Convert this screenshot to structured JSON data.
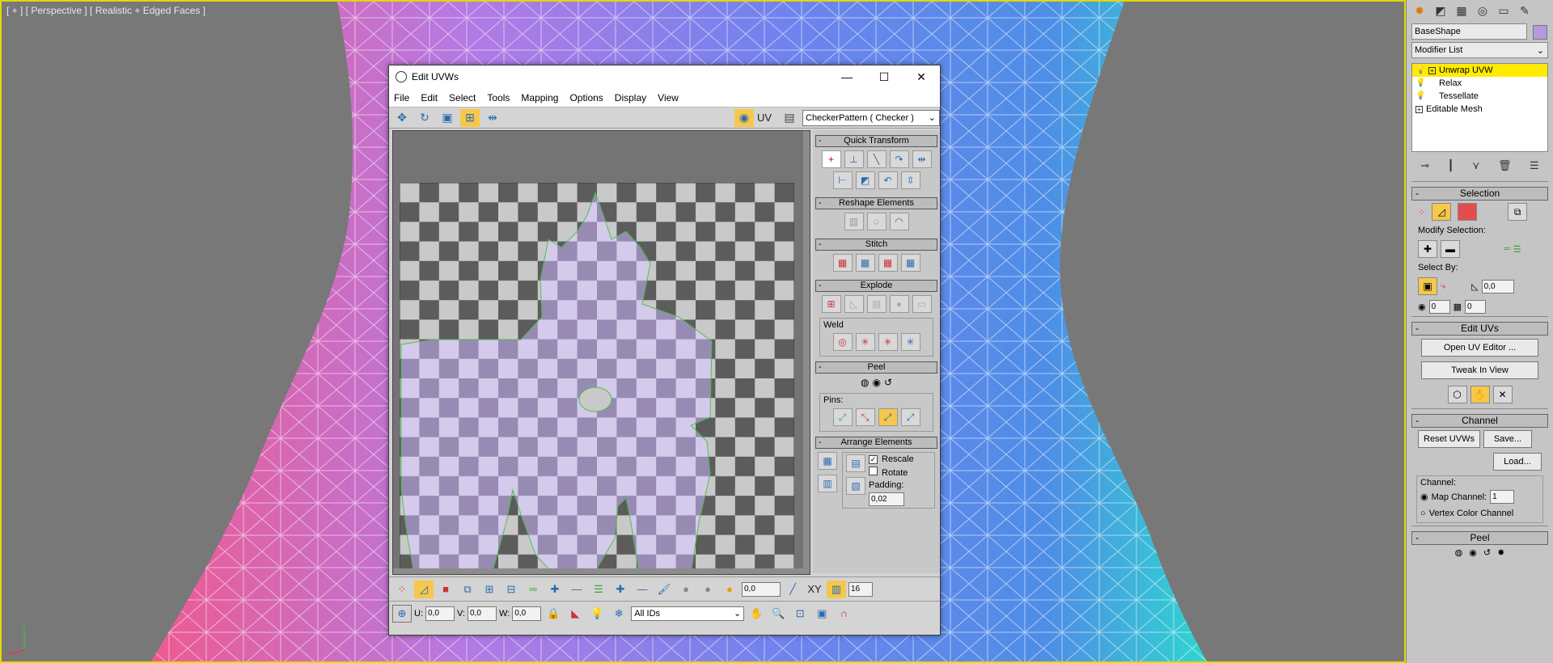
{
  "viewport": {
    "label": "[ + ] [ Perspective ] [ Realistic + Edged Faces ]"
  },
  "command_panel": {
    "object_name": "BaseShape",
    "modifier_list": "Modifier List",
    "modifiers": [
      {
        "label": "Unwrap UVW",
        "selected": true
      },
      {
        "label": "Relax",
        "selected": false
      },
      {
        "label": "Tessellate",
        "selected": false
      },
      {
        "label": "Editable Mesh",
        "selected": false
      }
    ],
    "selection": {
      "title": "Selection",
      "modify_selection": "Modify Selection:",
      "select_by": "Select By:",
      "angle_value": "0,0",
      "val1": "0",
      "val2": "0"
    },
    "edit_uvs": {
      "title": "Edit UVs",
      "open_button": "Open UV Editor ...",
      "tweak_button": "Tweak In View"
    },
    "channel": {
      "title": "Channel",
      "reset": "Reset UVWs",
      "save": "Save...",
      "load": "Load...",
      "channel_label": "Channel:",
      "map_channel": "Map Channel:",
      "map_channel_value": "1",
      "vertex_color": "Vertex Color Channel"
    },
    "peel_title": "Peel"
  },
  "uv_editor": {
    "title": "Edit UVWs",
    "menus": [
      "File",
      "Edit",
      "Select",
      "Tools",
      "Mapping",
      "Options",
      "Display",
      "View"
    ],
    "uv_label": "UV",
    "texture": "CheckerPattern  ( Checker )",
    "panels": {
      "quick_transform": "Quick Transform",
      "reshape": "Reshape Elements",
      "stitch": "Stitch",
      "explode": "Explode",
      "weld": "Weld",
      "peel": "Peel",
      "pins": "Pins:",
      "arrange": "Arrange Elements",
      "rescale": "Rescale",
      "rotate": "Rotate",
      "padding": "Padding:",
      "padding_value": "0,02"
    },
    "bottom": {
      "soft_value": "0,0",
      "xy_label": "XY",
      "grid_value": "16",
      "u_label": "U:",
      "u_value": "0,0",
      "v_label": "V:",
      "v_value": "0,0",
      "w_label": "W:",
      "w_value": "0,0",
      "ids": "All IDs"
    }
  },
  "colors": {
    "accent": "#f5c84c",
    "viewport_border": "#e3d700",
    "uv_shell": "#c4b0e8"
  }
}
